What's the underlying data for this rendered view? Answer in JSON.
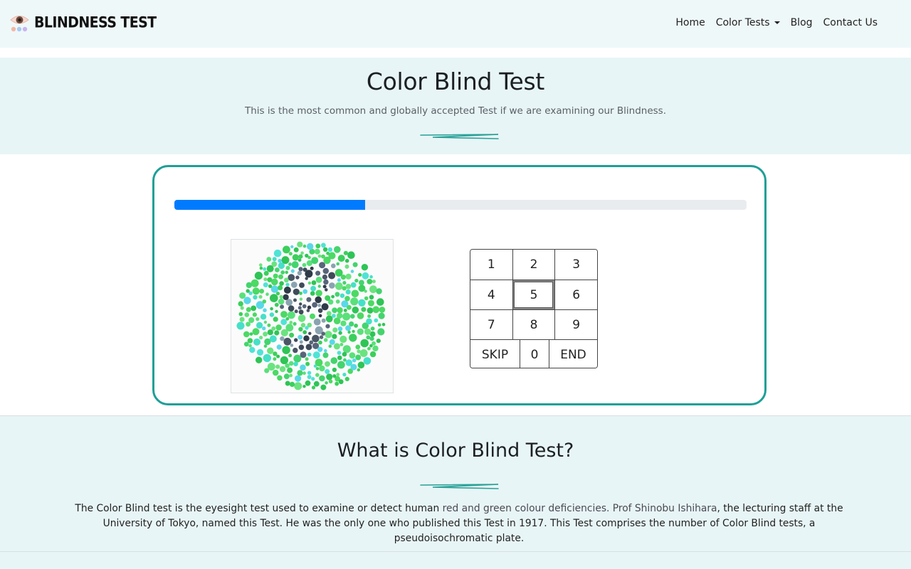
{
  "brand": {
    "name": "BLINDNESS TEST",
    "logo": "eye-logo-icon"
  },
  "nav": {
    "home": "Home",
    "color_tests": "Color Tests",
    "blog": "Blog",
    "contact": "Contact Us"
  },
  "hero": {
    "title": "Color Blind Test",
    "subtitle": "This is the most common and globally accepted Test if we are examining our Blindness."
  },
  "test": {
    "progress_fraction": 0.333,
    "plate": "ishihara-plate",
    "keypad": [
      [
        "1",
        "2",
        "3"
      ],
      [
        "4",
        "5",
        "6"
      ],
      [
        "7",
        "8",
        "9"
      ],
      [
        "SKIP",
        "0",
        "END"
      ]
    ],
    "focused_key": "5",
    "accent_color": "#1e9f97",
    "progress_color": "#007bff"
  },
  "about": {
    "title": "What is Color Blind Test?",
    "text_part1": "The Color Blind test is the eyesight test used to examine or detect human ",
    "text_highlight1": "red and green colour deficiencies. Prof Shinobu Ishihara",
    "text_part2": ", the lecturing staff at the University of Tokyo, named this Test. He was the only one who published this Test in 1917. This Test comprises the number of Color Blind tests, a pseudoisochromatic plate."
  }
}
